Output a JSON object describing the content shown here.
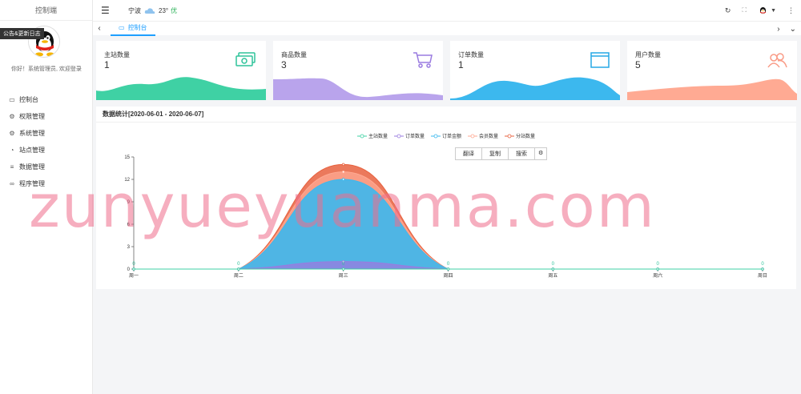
{
  "sidebar": {
    "brand": "控制端",
    "tooltip": "公告&更新日志",
    "greeting": "你好！系统管理员, 欢迎登录",
    "items": [
      {
        "label": "控制台",
        "icon": "monitor-icon"
      },
      {
        "label": "权限管理",
        "icon": "gear-icon"
      },
      {
        "label": "系统管理",
        "icon": "gear-icon"
      },
      {
        "label": "站点管理",
        "icon": "clock-icon"
      },
      {
        "label": "数据管理",
        "icon": "list-icon"
      },
      {
        "label": "程序管理",
        "icon": "link-icon"
      }
    ]
  },
  "topbar": {
    "city": "宁波",
    "temperature": "23°",
    "aqi": "优"
  },
  "tabs": [
    {
      "label": "控制台",
      "icon": "monitor-icon"
    }
  ],
  "cards": [
    {
      "title": "主站数量",
      "value": "1",
      "icon": "money-icon",
      "color": "#3fd1a4",
      "iconColor": "#2ec39a"
    },
    {
      "title": "商品数量",
      "value": "3",
      "icon": "cart-icon",
      "color": "#b9a4ec",
      "iconColor": "#9a7be0"
    },
    {
      "title": "订单数量",
      "value": "1",
      "icon": "window-icon",
      "color": "#3cb8ee",
      "iconColor": "#27a8e6"
    },
    {
      "title": "用户数量",
      "value": "5",
      "icon": "users-icon",
      "color": "#ffaa93",
      "iconColor": "#f99b86"
    }
  ],
  "panel": {
    "title": "数据统计[2020-06-01 - 2020-06-07]",
    "toolbox": [
      "翻译",
      "复制",
      "搜索"
    ]
  },
  "watermark": "zunyueyuanma.com",
  "chart_data": {
    "type": "area",
    "categories": [
      "周一",
      "周二",
      "周三",
      "周四",
      "周五",
      "周六",
      "周日"
    ],
    "ylim": [
      0,
      15
    ],
    "yticks": [
      0,
      3,
      6,
      9,
      12,
      15
    ],
    "legend_position": "top-center",
    "series": [
      {
        "name": "主站数量",
        "values": [
          0,
          0,
          0,
          0,
          0,
          0,
          0
        ],
        "color": "#3fd1a4"
      },
      {
        "name": "订单数量",
        "values": [
          0,
          0,
          1,
          0,
          0,
          0,
          0
        ],
        "color": "#9a7be0"
      },
      {
        "name": "订单金额",
        "values": [
          0,
          0,
          11,
          0,
          0,
          0,
          0
        ],
        "color": "#3cb8ee"
      },
      {
        "name": "会员数量",
        "values": [
          0,
          0,
          1,
          0,
          0,
          0,
          0
        ],
        "color": "#ffaa93"
      },
      {
        "name": "分站数量",
        "values": [
          0,
          0,
          1,
          0,
          0,
          0,
          0
        ],
        "color": "#e8623f"
      }
    ],
    "point_labels": [
      "0",
      "0",
      "0",
      "0",
      "0",
      "0",
      "0"
    ]
  }
}
